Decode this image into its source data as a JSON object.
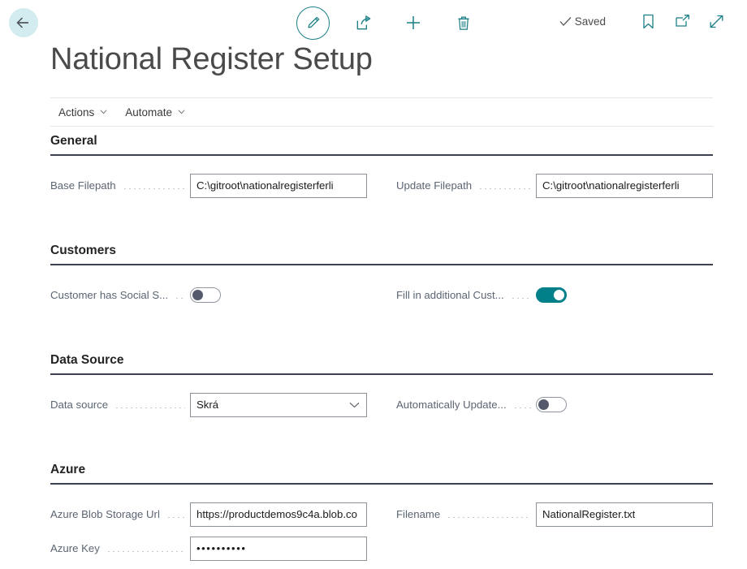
{
  "topbar": {
    "back_label": "Back",
    "saved_label": "Saved",
    "commands": [
      {
        "name": "edit-icon",
        "label": "Edit"
      },
      {
        "name": "share-icon",
        "label": "Share"
      },
      {
        "name": "new-icon",
        "label": "New"
      },
      {
        "name": "delete-icon",
        "label": "Delete"
      }
    ],
    "right_icons": [
      {
        "name": "bookmark-icon",
        "label": "Bookmark"
      },
      {
        "name": "open-in-new-window-icon",
        "label": "Open in new window"
      },
      {
        "name": "expand-icon",
        "label": "Expand"
      }
    ]
  },
  "page": {
    "title": "National Register Setup"
  },
  "menubar": {
    "items": [
      {
        "label": "Actions"
      },
      {
        "label": "Automate"
      }
    ]
  },
  "sections": {
    "general": {
      "title": "General",
      "base_filepath": {
        "label": "Base Filepath",
        "value": "C:\\gitroot\\nationalregisterferli"
      },
      "update_filepath": {
        "label": "Update Filepath",
        "value": "C:\\gitroot\\nationalregisterferli"
      }
    },
    "customers": {
      "title": "Customers",
      "customer_has_social": {
        "label": "Customer has Social S...",
        "value": "off"
      },
      "fill_additional": {
        "label": "Fill in additional Cust...",
        "value": "on"
      }
    },
    "data_source": {
      "title": "Data Source",
      "data_source": {
        "label": "Data source",
        "value": "Skrá"
      },
      "auto_update": {
        "label": "Automatically Update...",
        "value": "off"
      }
    },
    "azure": {
      "title": "Azure",
      "blob_url": {
        "label": "Azure Blob Storage Url",
        "value": "https://productdemos9c4a.blob.co"
      },
      "azure_key": {
        "label": "Azure Key",
        "value": "••••••••••"
      },
      "filename": {
        "label": "Filename",
        "value": "NationalRegister.txt"
      }
    }
  },
  "colors": {
    "accent_teal": "#018089",
    "back_circle": "#d3ecef",
    "section_rule": "#3c4051",
    "label_text": "#5b6573",
    "input_border": "#8a9199"
  }
}
